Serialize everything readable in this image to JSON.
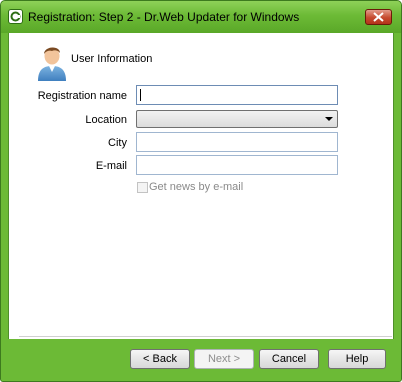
{
  "window": {
    "title": "Registration: Step 2 - Dr.Web Updater for Windows",
    "close_glyph": "✕"
  },
  "section": {
    "title": "User Information",
    "icon": "user-avatar-icon"
  },
  "form": {
    "registration_name": {
      "label": "Registration name",
      "value": ""
    },
    "location": {
      "label": "Location",
      "value": ""
    },
    "city": {
      "label": "City",
      "value": ""
    },
    "email": {
      "label": "E-mail",
      "value": ""
    },
    "news_checkbox": {
      "label": "Get news by e-mail",
      "checked": false,
      "enabled": false
    }
  },
  "buttons": {
    "back": "< Back",
    "next": "Next >",
    "cancel": "Cancel",
    "help": "Help"
  },
  "colors": {
    "frame": "#6cba36",
    "close_button": "#c64a2e"
  }
}
